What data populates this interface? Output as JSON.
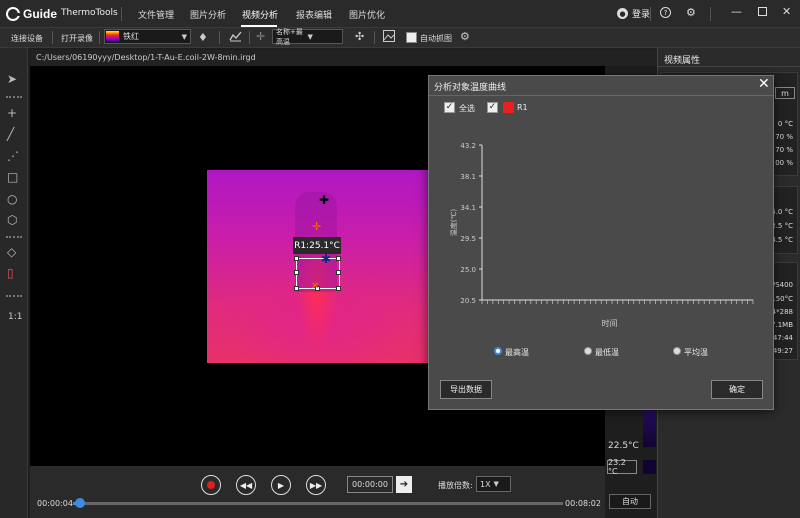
{
  "app": {
    "logo_text": "Guide",
    "title": "ThermoTools",
    "menu": [
      {
        "label": "文件管理"
      },
      {
        "label": "图片分析"
      },
      {
        "label": "视频分析"
      },
      {
        "label": "报表编辑"
      },
      {
        "label": "图片优化"
      }
    ],
    "active_menu": "视频分析",
    "login_label": "登录"
  },
  "toolbar": {
    "connect_label": "连接设备",
    "open_video_label": "打开录像",
    "palette_label": "铁红",
    "point_mode_label": "名称+最高温",
    "auto_capture_label": "自动抓图"
  },
  "file_path": "C:/Users/06190yyy/Desktop/1-T-Au-E.coil-2W-8min.irgd",
  "video": {
    "roi_label": "R1:25.1°C"
  },
  "right_panel": {
    "title": "视频属性",
    "section1_values": [
      "m",
      "0 °C",
      "70 %",
      "70 %",
      "00 %"
    ],
    "section2_values": [
      "5.0 °C",
      "2.5 °C",
      "4.5 °C"
    ],
    "section3_values": [
      "PS400",
      "150°C",
      "4*288",
      "7.1MB",
      ":47:44",
      "49:27"
    ]
  },
  "color_scale": {
    "bottom_value": "22.5°C",
    "min_value": "23.2 °C",
    "auto_label": "自动"
  },
  "playback": {
    "current_time": "00:00:04",
    "total_time": "00:08:02",
    "goto_time": "00:00:00",
    "speed_label": "播放倍数:",
    "speed_value": "1X",
    "progress": 0.008
  },
  "dialog": {
    "title": "分析对象温度曲线",
    "select_all_label": "全选",
    "series_label": "R1",
    "series_color": "#e82020",
    "radio_max": "最高温",
    "radio_min": "最低温",
    "radio_avg": "平均温",
    "export_label": "导出数据",
    "ok_label": "确定"
  },
  "chart_data": {
    "type": "line",
    "ylabel": "温度(℃)",
    "xlabel": "时间",
    "yticks": [
      "43.2",
      "38.1",
      "34.1",
      "29.5",
      "25.0",
      "20.5"
    ],
    "ylim": [
      20.5,
      43.2
    ],
    "series": []
  }
}
